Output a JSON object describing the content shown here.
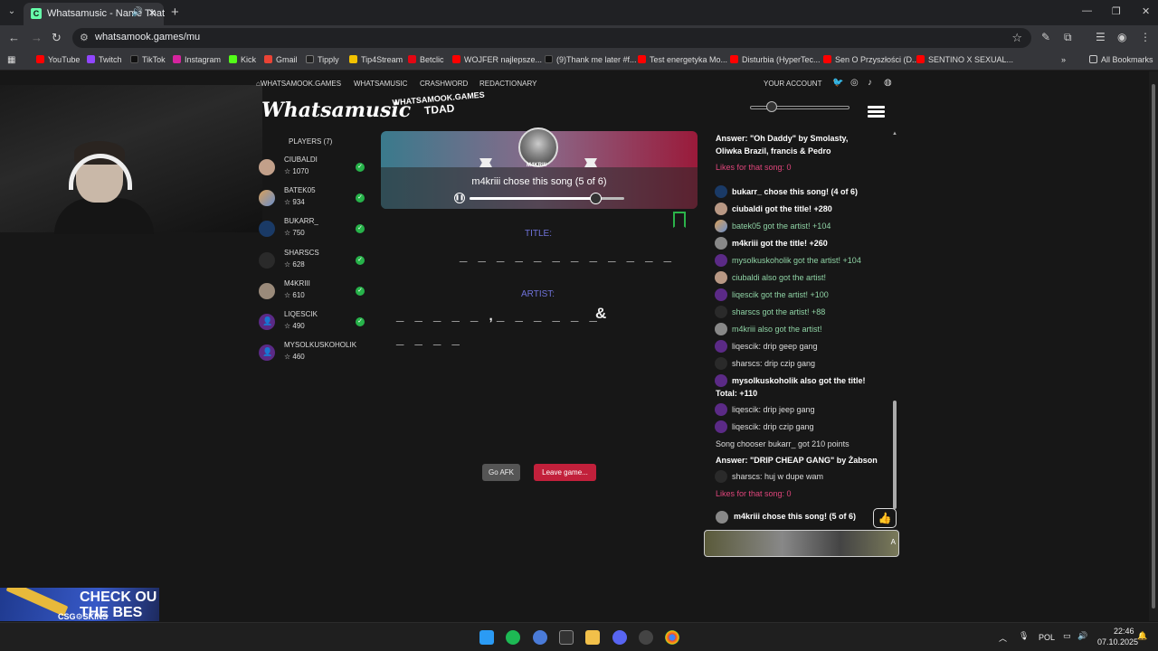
{
  "browser": {
    "tab_title": "Whatsamusic - Name That",
    "tab_favicon": "C",
    "url": "whatsamook.games/mu",
    "all_bookmarks": "All Bookmarks",
    "bookmarks": [
      "YouTube",
      "Twitch",
      "TikTok",
      "Instagram",
      "Kick",
      "Gmail",
      "Tipply",
      "Tip4Stream",
      "Betclic",
      "WOJFER najlepsze...",
      "(9)Thank me later #f...",
      "Test energetyka Mo...",
      "Disturbia (HyperTec...",
      "Sen O Przyszłości (D...",
      "SENTINO X SEXUAL..."
    ]
  },
  "site": {
    "nav": [
      "WHATSAMOOK.GAMES",
      "WHATSAMUSIC",
      "CRASHWORD",
      "REDACTIONARY"
    ],
    "account": "YOUR ACCOUNT",
    "logo": "Whatsamusic",
    "room_top": "WHATSAMOOK.GAMES",
    "room_code": "TDAD"
  },
  "players": {
    "title": "PLAYERS (7)",
    "list": [
      {
        "name": "CIUBALDI",
        "score": "1070",
        "guessed": true
      },
      {
        "name": "BATEK05",
        "score": "934",
        "guessed": true
      },
      {
        "name": "BUKARR_",
        "score": "750",
        "guessed": true
      },
      {
        "name": "SHARSCS",
        "score": "628",
        "guessed": true
      },
      {
        "name": "M4KRIII",
        "score": "610",
        "guessed": true
      },
      {
        "name": "LIQESCIK",
        "score": "490",
        "guessed": true
      },
      {
        "name": "MYSOLKUSKOHOLIK",
        "score": "460",
        "guessed": false
      }
    ]
  },
  "song": {
    "chooser_avatar_name": "M4KRIII",
    "status": "m4kriii chose this song (5 of 6)",
    "progress": 0.82,
    "title_label": "TITLE:",
    "title_blanks": "_ _ _ _ _ _ _ _ _ _ _ _",
    "artist_label": "ARTIST:",
    "artist_blanks_1": "_ _ _ _ _ ,",
    "artist_blanks_2": "_ _ _ _ _ _",
    "artist_amp": "&",
    "artist_blanks_3": "_ _ _ _"
  },
  "buttons": {
    "afk": "Go AFK",
    "leave": "Leave game..."
  },
  "chat": {
    "messages": [
      {
        "text": "Answer: \"Oh Daddy\" by Smolasty,",
        "style": "white",
        "avatar": null
      },
      {
        "text": "Oliwka Brazil, francis & Pedro",
        "style": "white",
        "avatar": null
      },
      {
        "text": "Likes for that song: 0",
        "style": "pink",
        "avatar": null
      },
      {
        "text": "bukarr_ chose this song! (4 of 6)",
        "style": "white",
        "avatar": "blue"
      },
      {
        "text": "ciubaldi got the title! +280",
        "style": "white",
        "avatar": "photo"
      },
      {
        "text": "batek05 got the artist! +104",
        "style": "green",
        "avatar": "mix"
      },
      {
        "text": "m4kriii got the title! +260",
        "style": "white",
        "avatar": "gray"
      },
      {
        "text": "mysolkuskoholik got the artist! +104",
        "style": "green",
        "avatar": "def"
      },
      {
        "text": "ciubaldi also got the artist!",
        "style": "green",
        "avatar": "photo"
      },
      {
        "text": "liqescik got the artist! +100",
        "style": "green",
        "avatar": "def"
      },
      {
        "text": "sharscs got the artist! +88",
        "style": "green",
        "avatar": "dark"
      },
      {
        "text": "m4kriii also got the artist!",
        "style": "green",
        "avatar": "gray"
      },
      {
        "text": "liqescik: drip geep gang",
        "style": "plain",
        "avatar": "def"
      },
      {
        "text": "sharscs: drip czip gang",
        "style": "plain",
        "avatar": "dark"
      },
      {
        "text": "mysolkuskoholik also got the title!",
        "style": "white",
        "avatar": "def"
      },
      {
        "text": "Total: +110",
        "style": "white",
        "avatar": null
      },
      {
        "text": "liqescik: drip jeep gang",
        "style": "plain",
        "avatar": "def"
      },
      {
        "text": "liqescik: drip czip gang",
        "style": "plain",
        "avatar": "def"
      },
      {
        "text": "Song chooser bukarr_ got 210 points",
        "style": "plain",
        "avatar": null
      },
      {
        "text": "Answer: \"DRIP CHEAP GANG\" by Żabson",
        "style": "white",
        "avatar": null
      },
      {
        "text": "sharscs: huj w dupe wam",
        "style": "plain",
        "avatar": "dark"
      },
      {
        "text": "Likes for that song: 0",
        "style": "pink",
        "avatar": null
      }
    ],
    "chooser_banner": "m4kriii chose this song! (5 of 6)",
    "like_icon": "thumbs-up-icon",
    "input_badge": "A"
  },
  "ad": {
    "text_1": "CHECK OU",
    "text_2": "THE BES",
    "brand": "CSG⚙SKINS"
  },
  "taskbar": {
    "language": "POL",
    "time": "22:46",
    "date": "07.10.2025"
  },
  "colors": {
    "accent_purple": "#6f72d9",
    "guessed_green": "#27b34a",
    "leave_red": "#c2203b",
    "chat_pink": "#e0457b",
    "chat_green": "#8fd3a5"
  }
}
